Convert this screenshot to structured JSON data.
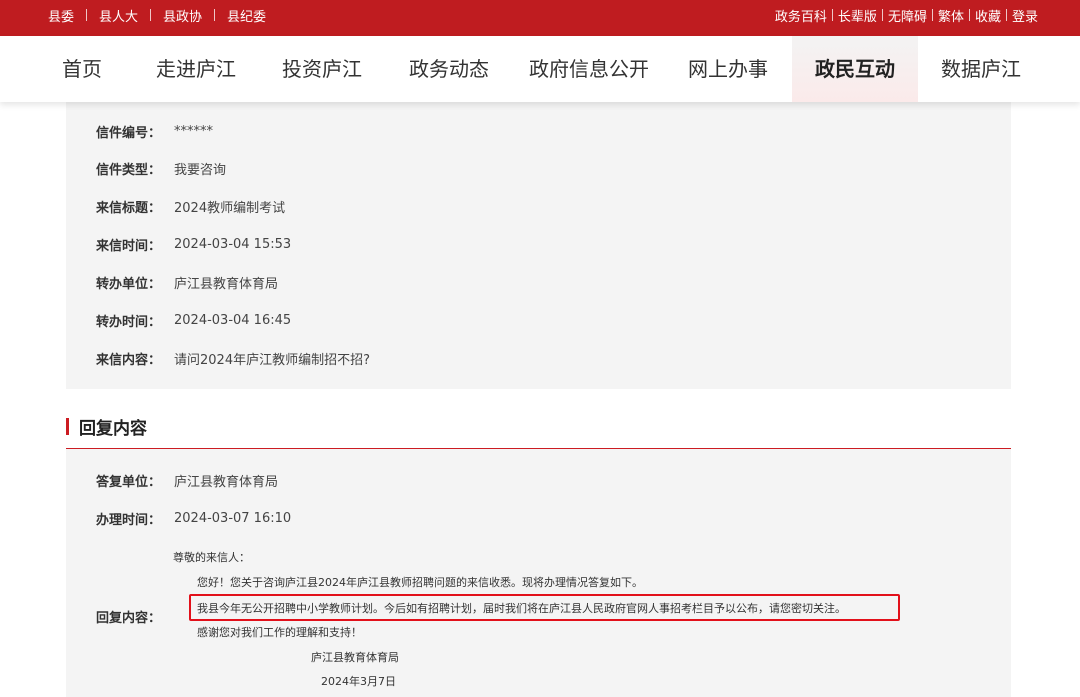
{
  "topbar": {
    "left_links": [
      "县委",
      "县人大",
      "县政协",
      "县纪委"
    ],
    "right_links": [
      "政务百科",
      "长辈版",
      "无障碍",
      "繁体",
      "收藏",
      "登录"
    ],
    "bg_color": "#bf1c20"
  },
  "nav": {
    "items": [
      "首页",
      "走进庐江",
      "投资庐江",
      "政务动态",
      "政府信息公开",
      "网上办事",
      "政民互动",
      "数据庐江"
    ],
    "active": "政民互动"
  },
  "letter": {
    "fields": [
      {
        "label": "信件编号：",
        "value": "******"
      },
      {
        "label": "信件类型：",
        "value": "我要咨询"
      },
      {
        "label": "来信标题：",
        "value": "2024教师编制考试"
      },
      {
        "label": "来信时间：",
        "value": "2024-03-04 15:53"
      },
      {
        "label": "转办单位：",
        "value": "庐江县教育体育局"
      },
      {
        "label": "转办时间：",
        "value": "2024-03-04 16:45"
      },
      {
        "label": "来信内容：",
        "value": "请问2024年庐江教师编制招不招?"
      }
    ]
  },
  "reply_section": {
    "title": "回复内容",
    "accent_color": "#cc1c22",
    "fields": [
      {
        "label": "答复单位：",
        "value": "庐江县教育体育局"
      },
      {
        "label": "办理时间：",
        "value": "2024-03-07 16:10"
      }
    ],
    "content_label": "回复内容：",
    "content": {
      "greeting": "尊敬的来信人：",
      "line1": "您好！您关于咨询庐江县2024年庐江县教师招聘问题的来信收悉。现将办理情况答复如下。",
      "line2": "我县今年无公开招聘中小学教师计划。今后如有招聘计划，届时我们将在庐江县人民政府官网人事招考栏目予以公布，请您密切关注。",
      "line3": "感谢您对我们工作的理解和支持！",
      "signature": "庐江县教育体育局",
      "date": "2024年3月7日"
    }
  }
}
